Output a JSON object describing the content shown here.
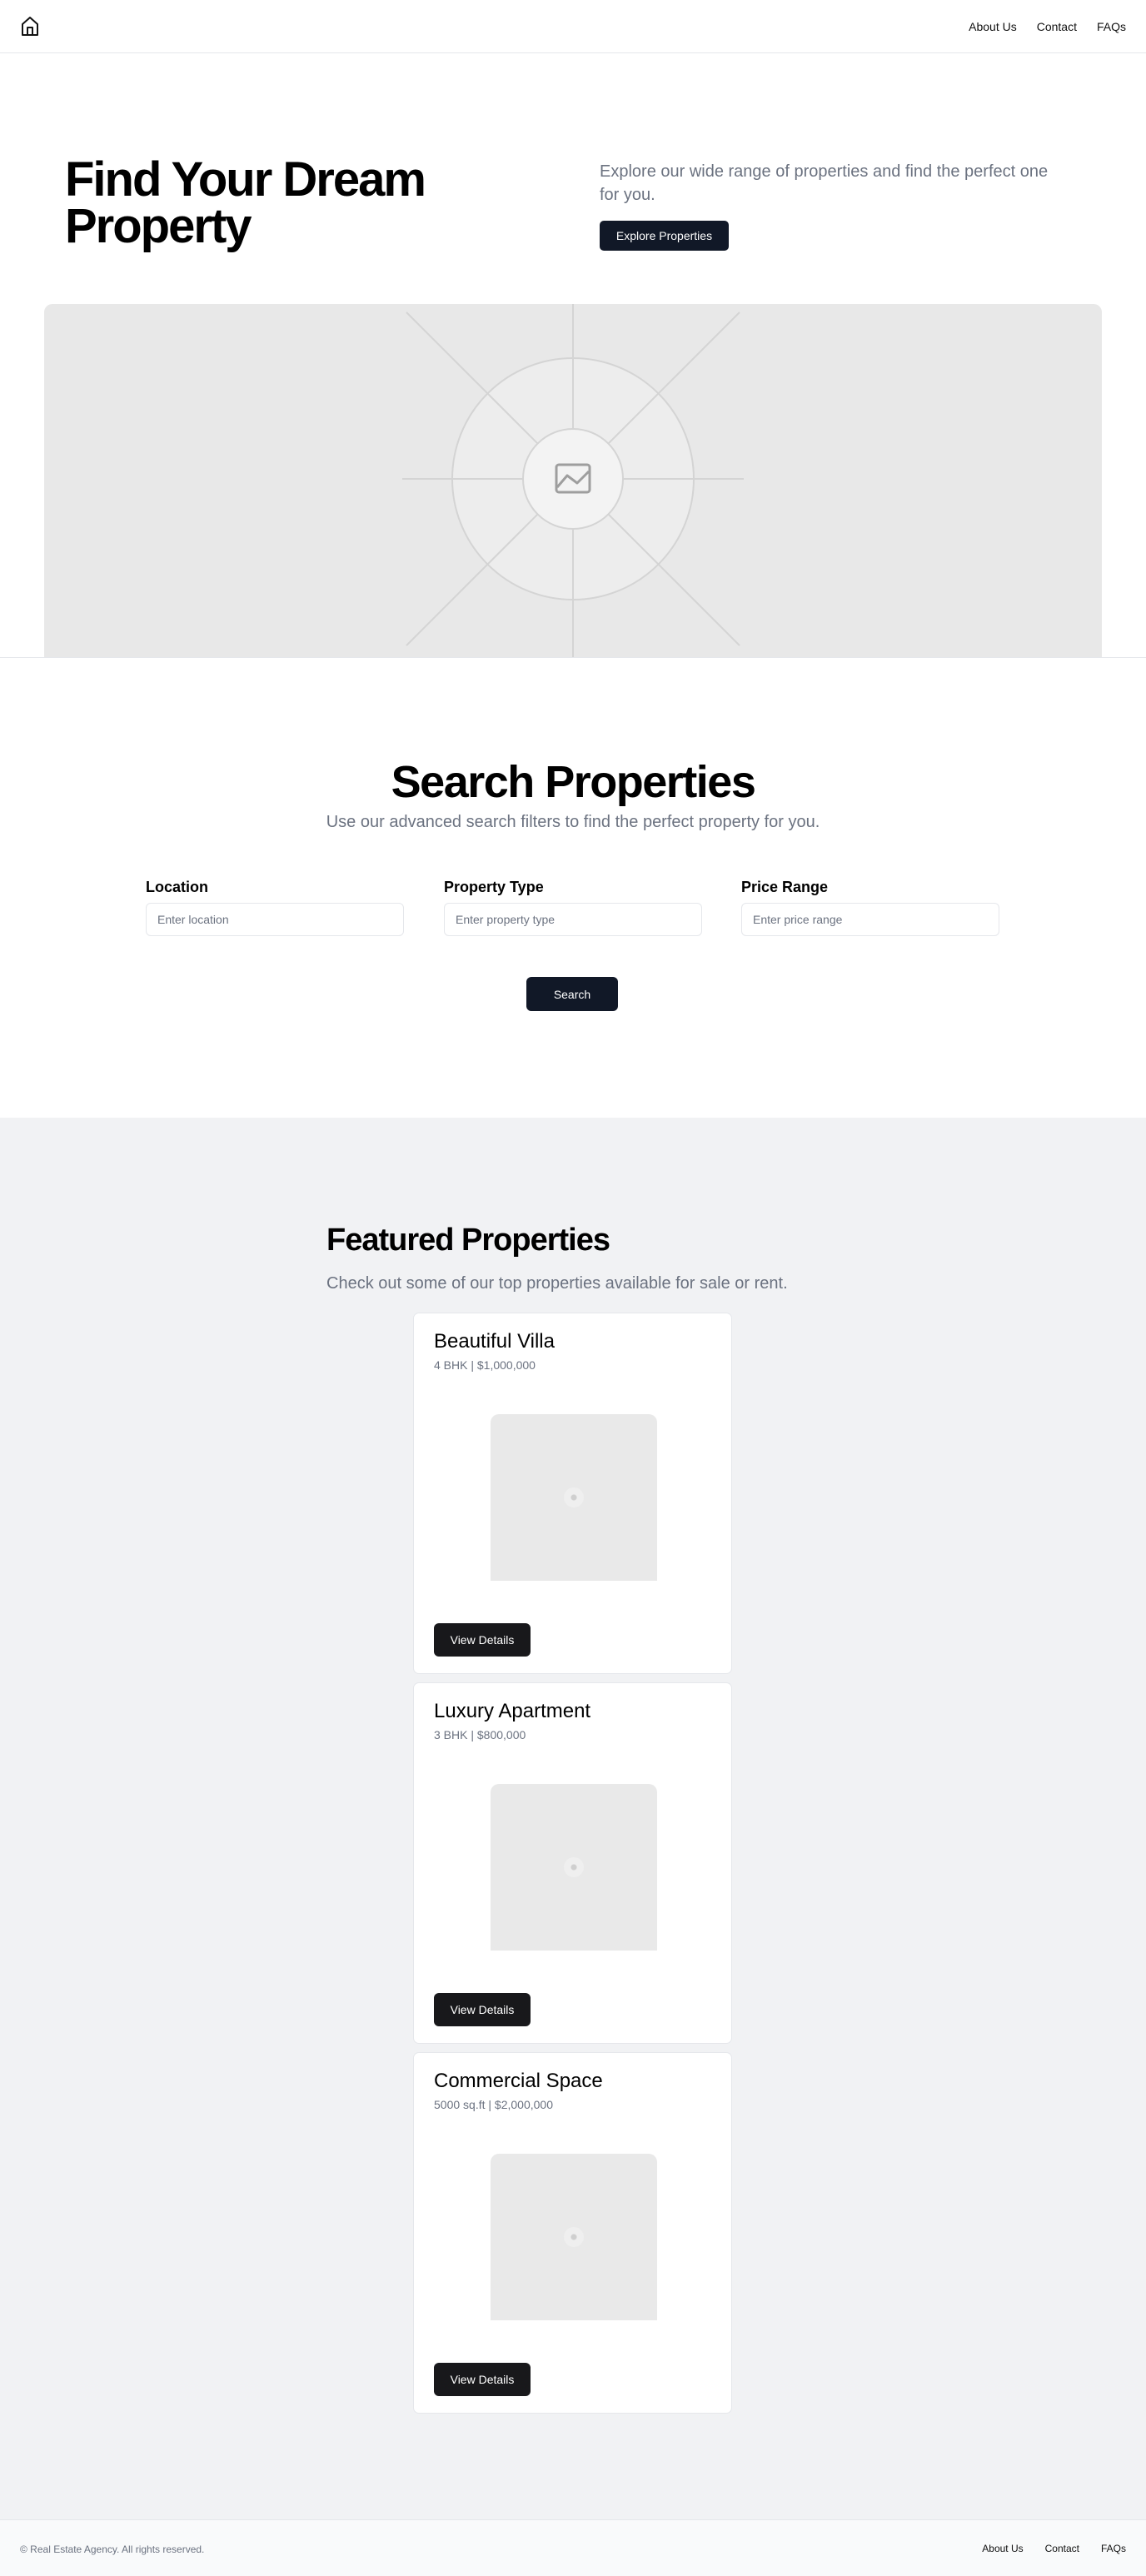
{
  "header": {
    "logo_icon": "home-icon",
    "nav": [
      "About Us",
      "Contact",
      "FAQs"
    ]
  },
  "hero": {
    "title": "Find Your Dream Property",
    "subtitle": "Explore our wide range of properties and find the perfect one for you.",
    "button": "Explore Properties",
    "image_icon": "image-placeholder-icon"
  },
  "search": {
    "title": "Search Properties",
    "subtitle": "Use our advanced search filters to find the perfect property for you.",
    "fields": [
      {
        "label": "Location",
        "placeholder": "Enter location",
        "value": ""
      },
      {
        "label": "Property Type",
        "placeholder": "Enter property type",
        "value": ""
      },
      {
        "label": "Price Range",
        "placeholder": "Enter price range",
        "value": ""
      }
    ],
    "button": "Search"
  },
  "featured": {
    "title": "Featured Properties",
    "subtitle": "Check out some of our top properties available for sale or rent.",
    "cards": [
      {
        "title": "Beautiful Villa",
        "meta": "4 BHK | $1,000,000",
        "button": "View Details"
      },
      {
        "title": "Luxury Apartment",
        "meta": "3 BHK | $800,000",
        "button": "View Details"
      },
      {
        "title": "Commercial Space",
        "meta": "5000 sq.ft | $2,000,000",
        "button": "View Details"
      }
    ]
  },
  "footer": {
    "copyright": "© Real Estate Agency. All rights reserved.",
    "nav": [
      "About Us",
      "Contact",
      "FAQs"
    ]
  },
  "colors": {
    "primary_button": "#111827",
    "card_button": "#18181b",
    "muted_text": "#6b7280",
    "section_bg": "#f1f2f4"
  }
}
